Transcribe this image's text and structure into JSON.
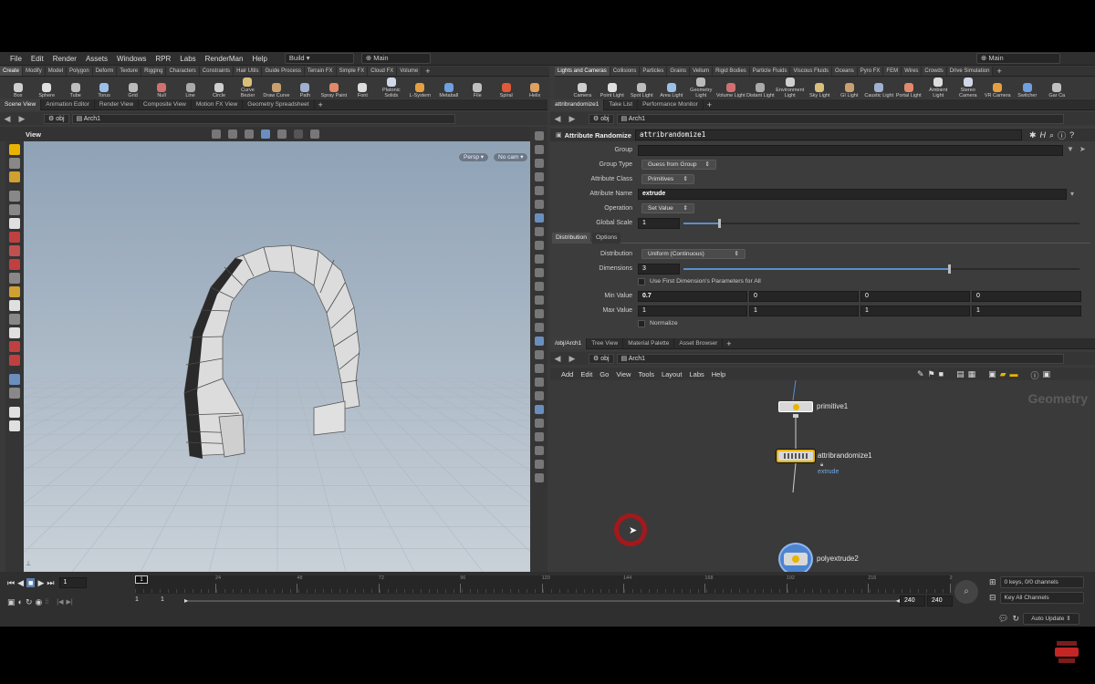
{
  "menu": {
    "items": [
      "File",
      "Edit",
      "Render",
      "Assets",
      "Windows",
      "RPR",
      "Labs",
      "RenderMan",
      "Help"
    ],
    "desktop": "Build",
    "main": "Main",
    "right_main": "Main"
  },
  "shelf_left": {
    "tabs": [
      "Create",
      "Modify",
      "Model",
      "Polygon",
      "Deform",
      "Texture",
      "Rigging",
      "Characters",
      "Constraints",
      "Hair Utils",
      "Guide Process",
      "Terrain FX",
      "Simple FX",
      "Cloud FX",
      "Volume"
    ],
    "tools": [
      "Box",
      "Sphere",
      "Tube",
      "Torus",
      "Grid",
      "Null",
      "Line",
      "Circle",
      "Curve Bezier",
      "Draw Curve",
      "Path",
      "Spray Paint",
      "Font",
      "Platonic Solids",
      "L-System",
      "Metaball",
      "File",
      "Spiral",
      "Helix"
    ]
  },
  "shelf_right": {
    "tabs": [
      "Lights and Cameras",
      "Collisions",
      "Particles",
      "Grains",
      "Vellum",
      "Rigid Bodies",
      "Particle Fluids",
      "Viscous Fluids",
      "Oceans",
      "Pyro FX",
      "FEM",
      "Wires",
      "Crowds",
      "Drive Simulation"
    ],
    "tools": [
      "Camera",
      "Point Light",
      "Spot Light",
      "Area Light",
      "Geometry Light",
      "Volume Light",
      "Distant Light",
      "Environment Light",
      "Sky Light",
      "GI Light",
      "Caustic Light",
      "Portal Light",
      "Ambient Light",
      "Stereo Camera",
      "VR Camera",
      "Switcher",
      "Gar Ca"
    ]
  },
  "left_panel": {
    "tabs": [
      "Scene View",
      "Animation Editor",
      "Render View",
      "Composite View",
      "Motion FX View",
      "Geometry Spreadsheet"
    ],
    "path_root": "obj",
    "path_node": "Arch1",
    "view_label": "View",
    "persp": "Persp",
    "cam": "No cam"
  },
  "right_top": {
    "tabs": [
      "attribrandomize1",
      "Take List",
      "Performance Monitor"
    ],
    "path_root": "obj",
    "path_node": "Arch1"
  },
  "params": {
    "node_type": "Attribute Randomize",
    "node_name": "attribrandomize1",
    "group_label": "Group",
    "group_value": "",
    "group_type_label": "Group Type",
    "group_type_value": "Guess from Group",
    "attr_class_label": "Attribute Class",
    "attr_class_value": "Primitives",
    "attr_name_label": "Attribute Name",
    "attr_name_value": "extrude",
    "operation_label": "Operation",
    "operation_value": "Set Value",
    "global_scale_label": "Global Scale",
    "global_scale_value": "1",
    "global_scale_fraction": 0.09,
    "tabs": [
      "Distribution",
      "Options"
    ],
    "distribution_label": "Distribution",
    "distribution_value": "Uniform (Continuous)",
    "dimensions_label": "Dimensions",
    "dimensions_value": "3",
    "dimensions_fraction": 0.67,
    "use_first_dim_label": "Use First Dimension's Parameters for All",
    "min_label": "Min Value",
    "min_values": [
      "0.7",
      "0",
      "0",
      "0"
    ],
    "max_label": "Max Value",
    "max_values": [
      "1",
      "1",
      "1",
      "1"
    ],
    "normalize_label": "Normalize"
  },
  "network": {
    "tabs": [
      "/obj/Arch1",
      "Tree View",
      "Material Palette",
      "Asset Browser"
    ],
    "path_root": "obj",
    "path_node": "Arch1",
    "menu": [
      "Add",
      "Edit",
      "Go",
      "View",
      "Tools",
      "Layout",
      "Labs",
      "Help"
    ],
    "context_label": "Geometry",
    "nodes": {
      "n1": "primitive1",
      "n2": "attribrandomize1",
      "n2_sub": "extrude",
      "n3": "polyextrude2"
    }
  },
  "timeline": {
    "frame": "1",
    "ticks": [
      "24",
      "48",
      "72",
      "96",
      "120",
      "144",
      "168",
      "192",
      "216",
      "2"
    ],
    "start_a": "1",
    "start_b": "1",
    "end_a": "240",
    "end_b": "240",
    "keys": "0 keys, 0/0 channels",
    "key_all": "Key All Channels",
    "auto_update": "Auto Update"
  },
  "colors": {
    "accent": "#e8b400",
    "viewport_top": "#8fa2b6",
    "viewport_bottom": "#c7cfd6",
    "cursor_ring": "#b0151a"
  }
}
